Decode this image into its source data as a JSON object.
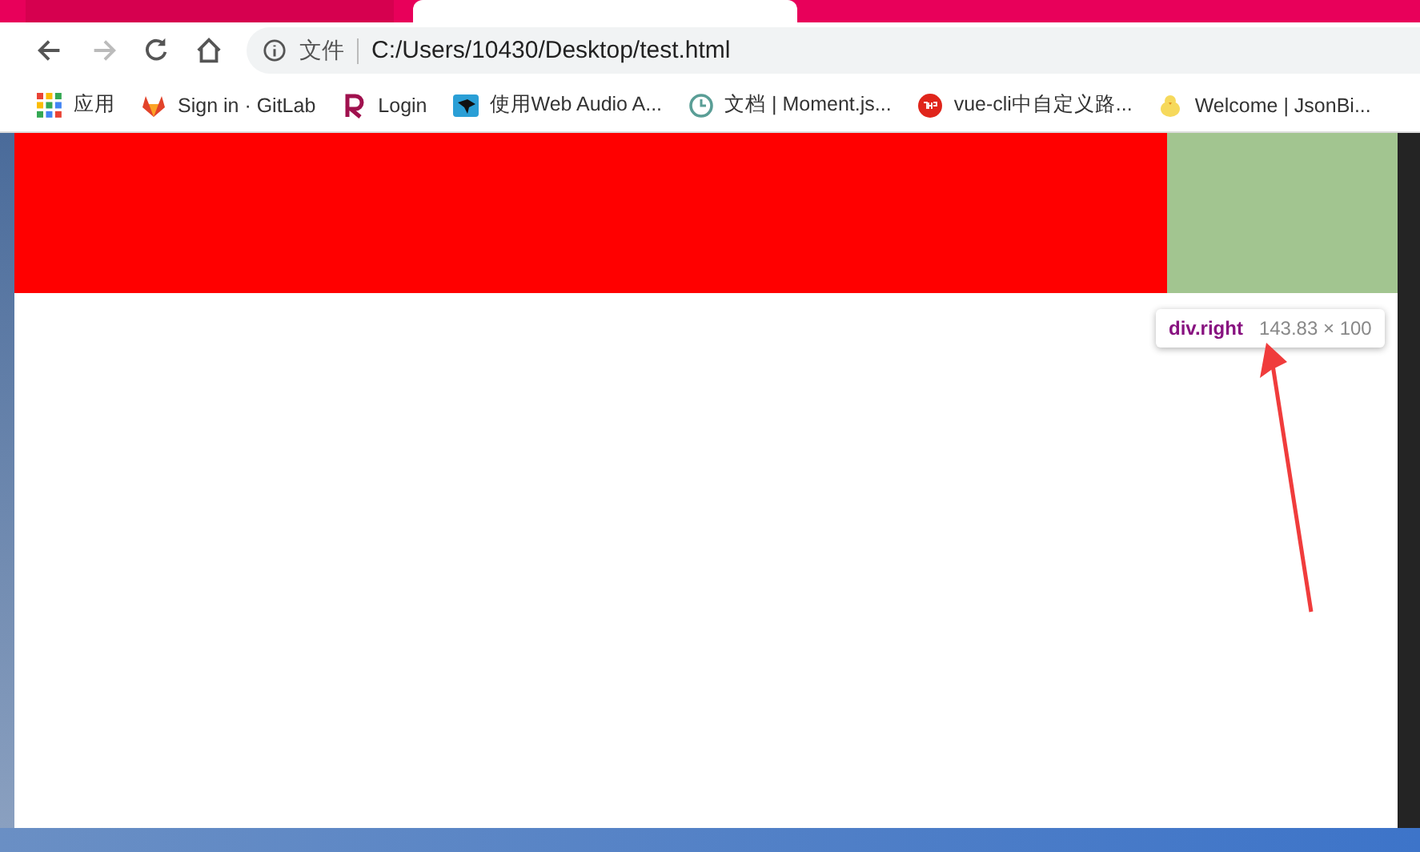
{
  "address_bar": {
    "security_label": "文件",
    "url": "C:/Users/10430/Desktop/test.html"
  },
  "bookmarks": [
    {
      "label": "应用",
      "kind": "apps"
    },
    {
      "label": "Sign in · GitLab",
      "kind": "fox"
    },
    {
      "label": "Login",
      "kind": "r"
    },
    {
      "label": "使用Web Audio A...",
      "kind": "bird"
    },
    {
      "label": "文档 | Moment.js...",
      "kind": "clock"
    },
    {
      "label": "vue-cli中自定义路...",
      "kind": "php"
    },
    {
      "label": "Welcome | JsonBi...",
      "kind": "chick"
    }
  ],
  "page": {
    "boxes": [
      {
        "color": "#ff0000"
      },
      {
        "color": "#a2c590"
      }
    ],
    "tooltip": {
      "selector": "div.right",
      "size": "143.83 × 100"
    }
  }
}
